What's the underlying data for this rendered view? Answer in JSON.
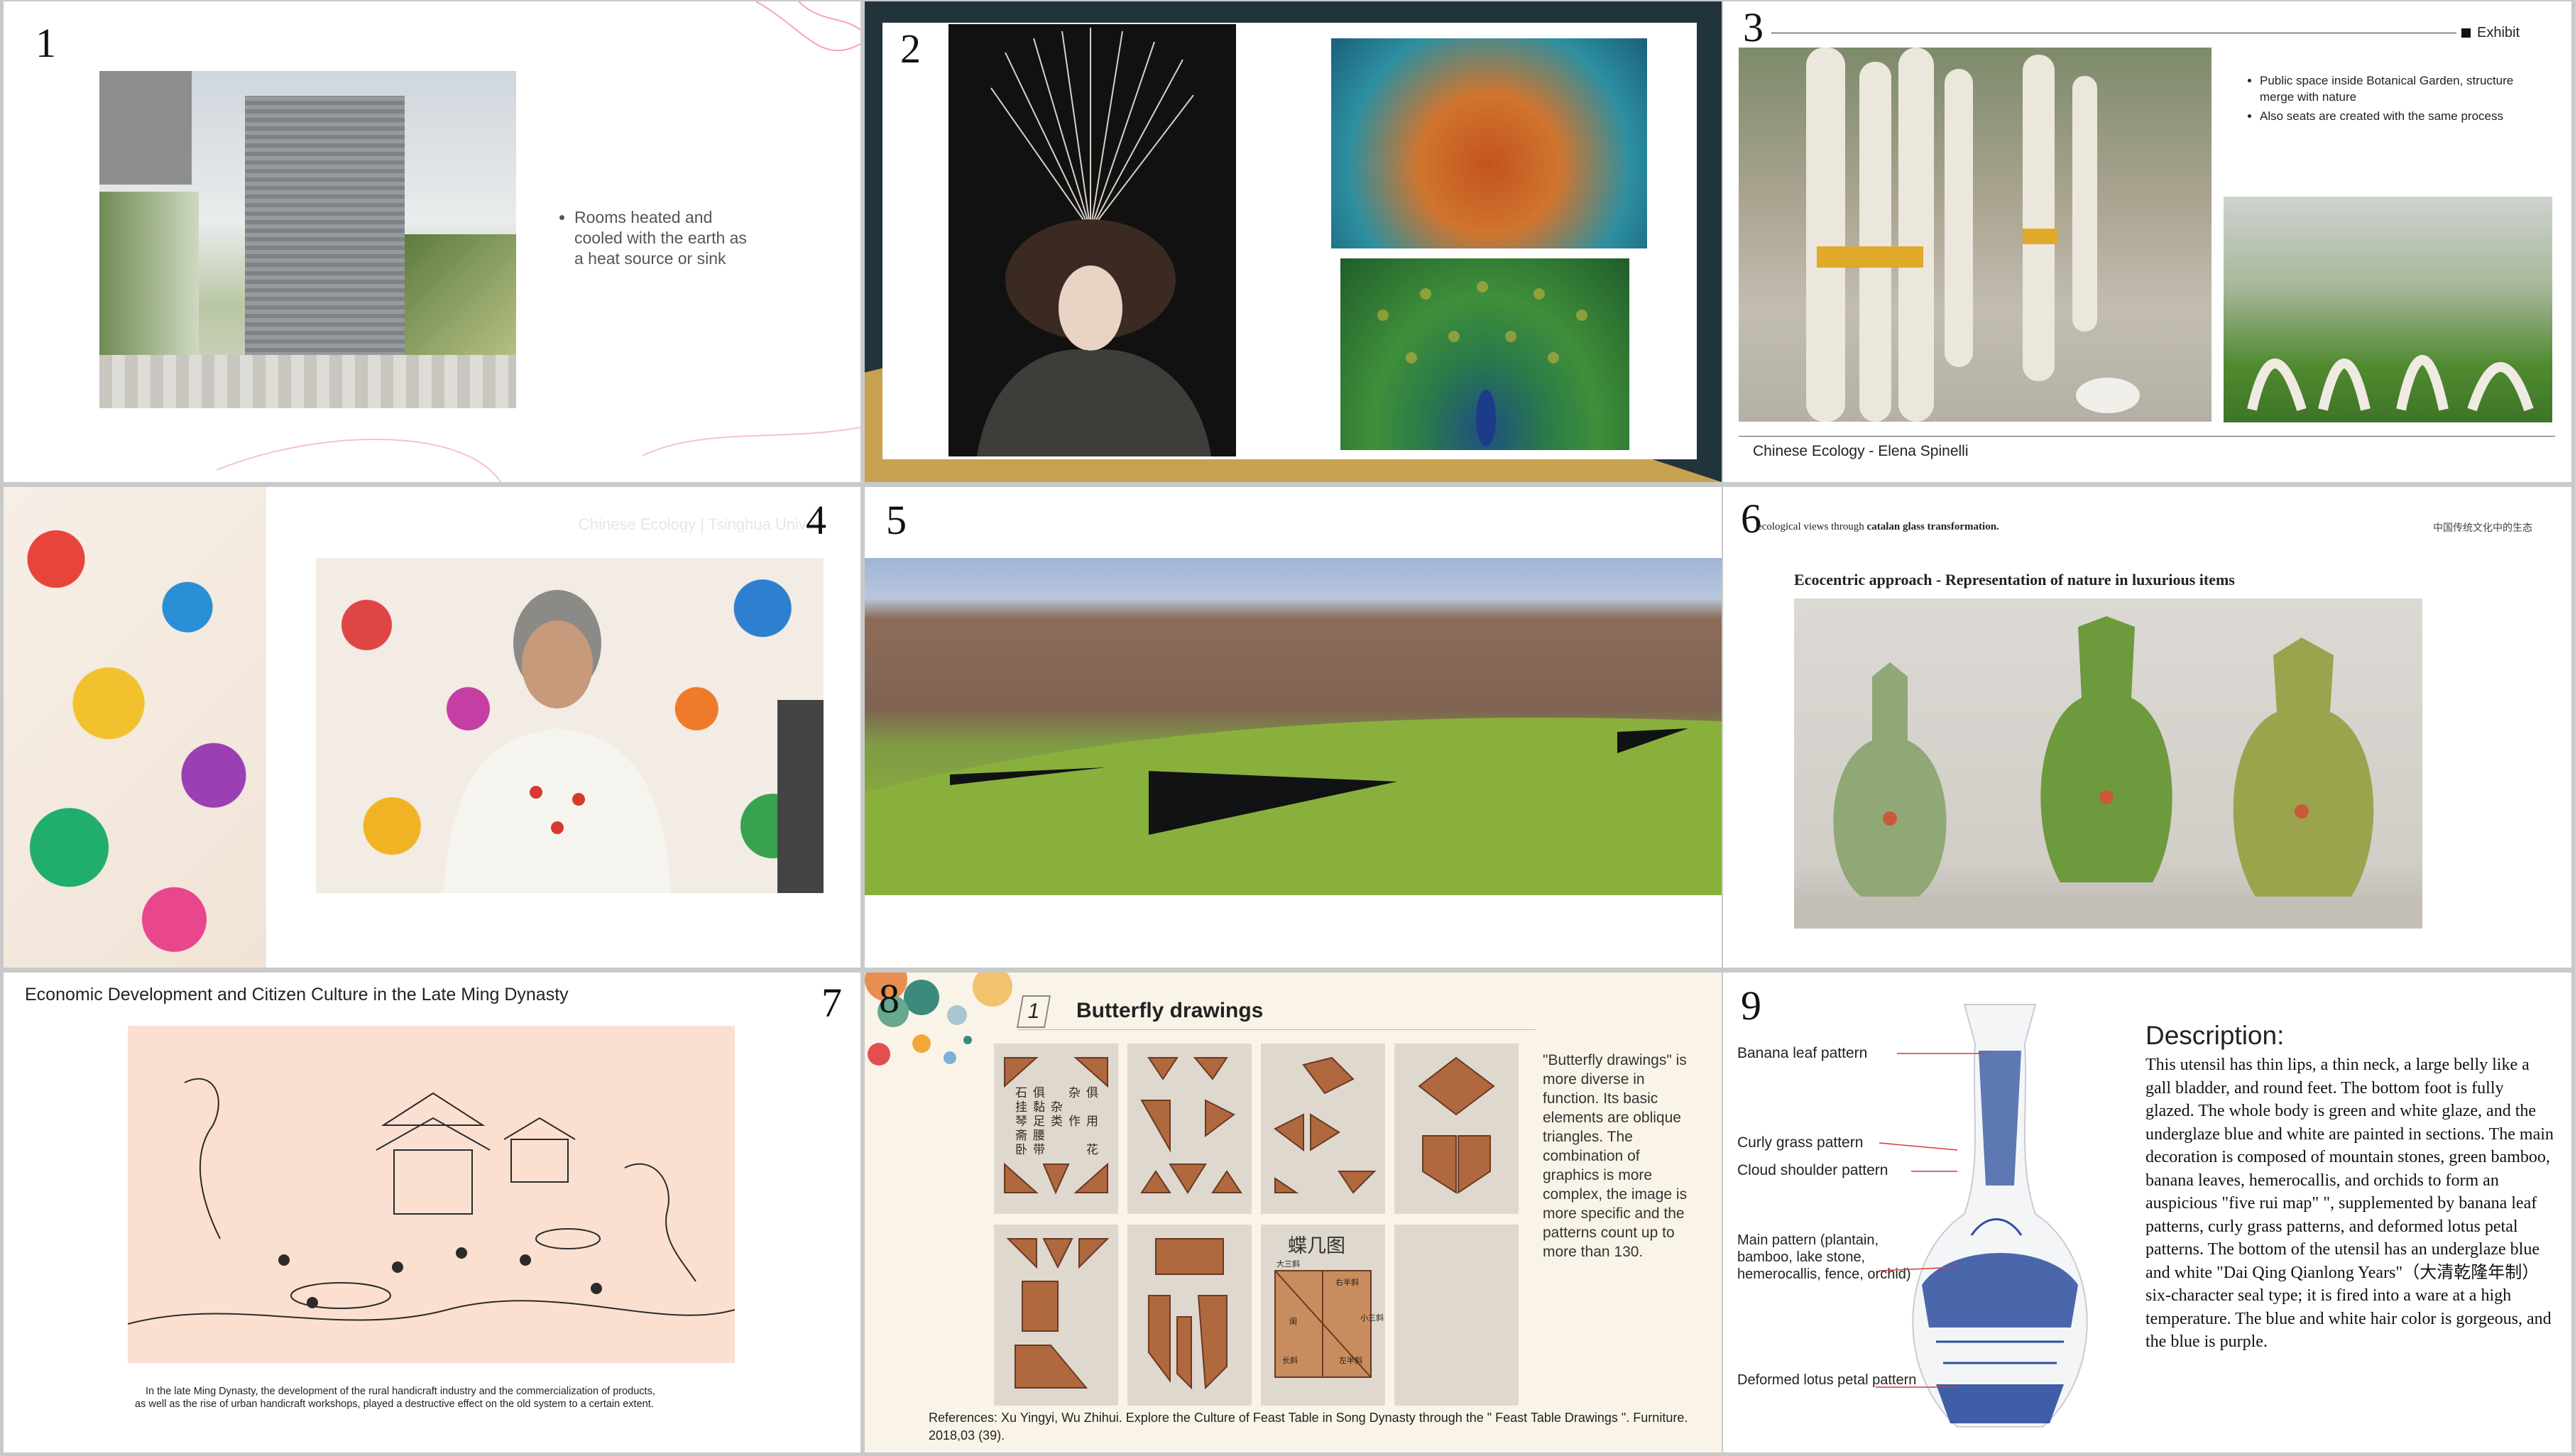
{
  "slides": [
    {
      "number": "1",
      "bullets": [
        "Rooms heated and cooled with the earth as a heat source or sink"
      ]
    },
    {
      "number": "2"
    },
    {
      "number": "3",
      "header_label": "Exhibit",
      "bullets": [
        "Public space inside Botanical Garden, structure merge with nature",
        "Also seats are created with the same process"
      ],
      "caption": "Chinese Ecology - Elena Spinelli"
    },
    {
      "number": "4",
      "watermark": "Chinese Ecology | Tsinghua Univer"
    },
    {
      "number": "5"
    },
    {
      "number": "6",
      "header_left_prefix": "ecological views through ",
      "header_left_bold": "catalan glass transformation.",
      "header_right": "中国传统文化中的生态",
      "subtitle": "Ecocentric approach - Representation of nature in luxurious items"
    },
    {
      "number": "7",
      "title": "Economic Development and Citizen Culture in the Late Ming Dynasty",
      "caption_line1": "In the late Ming Dynasty, the development of the rural handicraft industry and the commercialization of products,",
      "caption_line2": "as well as the rise of urban handicraft workshops, played a destructive effect on the old system to a certain extent."
    },
    {
      "number": "8",
      "section_number": "1",
      "title": "Butterfly drawings",
      "body": "\"Butterfly drawings\" is more diverse in function. Its basic elements are oblique triangles. The combination of graphics is more complex, the image is more specific and the patterns count up to more than 130.",
      "card_title": "蝶几图",
      "card1_labels": [
        "石",
        "俱",
        "挂",
        "黏",
        "杂",
        "琴",
        "足",
        "类",
        "斋",
        "腰",
        "卧",
        "带",
        "杂",
        "作",
        "俱",
        "用",
        "花"
      ],
      "card9_labels": [
        "大三斜",
        "右半斜",
        "小三斜",
        "闺",
        "左半斜",
        "长斜"
      ],
      "reference": "References: Xu Yingyi, Wu Zhihui. Explore the Culture of Feast Table in Song Dynasty through the \" Feast Table Drawings \". Furniture. 2018,03 (39)."
    },
    {
      "number": "9",
      "description_title": "Description:",
      "description": "This utensil has thin lips, a thin neck, a large belly like a gall bladder, and round feet. The bottom foot is fully glazed. The whole body is green and white glaze, and the underglaze blue and white are painted in sections. The main decoration is composed of mountain stones, green bamboo, banana leaves, hemerocallis, and orchids to form an auspicious \"five rui map\" \", supplemented by banana leaf patterns, curly grass patterns, and deformed lotus petal patterns. The bottom of the utensil has an underglaze blue and white \"Dai Qing Qianlong Years\"（大清乾隆年制） six-character seal type; it is fired into a ware at a high temperature. The blue and white hair color is gorgeous, and the blue is purple.",
      "labels": [
        "Banana leaf pattern",
        "Curly grass pattern",
        "Cloud shoulder pattern",
        "Main pattern (plantain, bamboo, lake stone, hemerocallis, fence, orchid)",
        "Deformed lotus petal pattern"
      ]
    }
  ]
}
